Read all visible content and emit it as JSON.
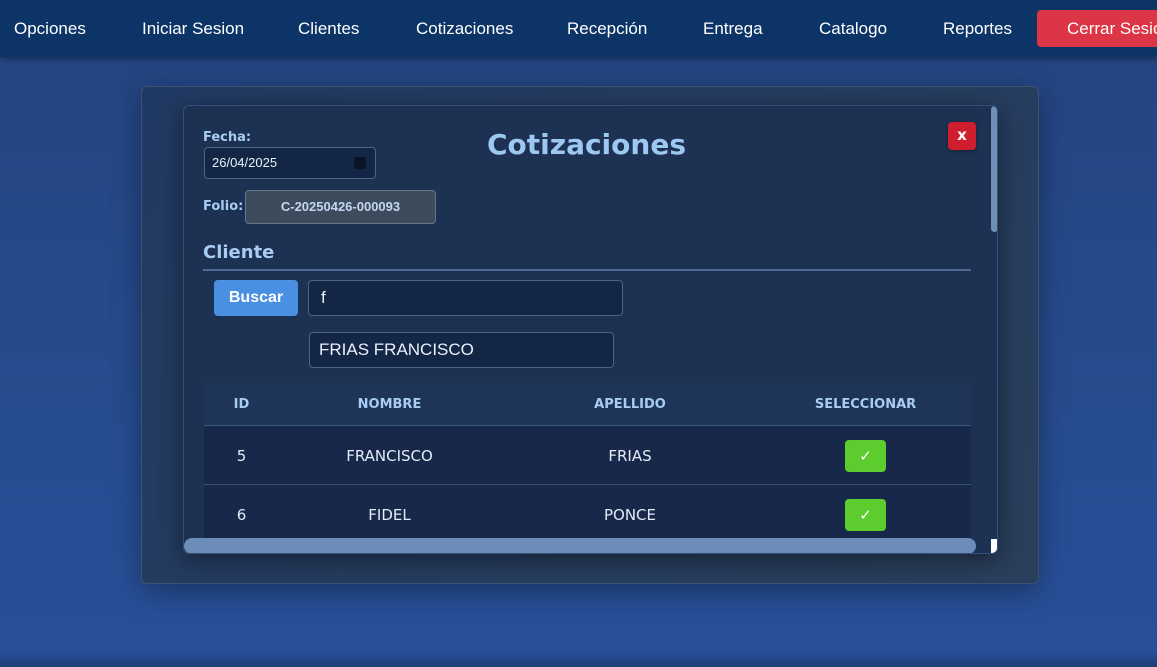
{
  "nav": {
    "items": [
      "Opciones",
      "Iniciar Sesion",
      "Clientes",
      "Cotizaciones",
      "Recepción",
      "Entrega",
      "Catalogo",
      "Reportes"
    ],
    "logout_label": "Cerrar Sesion",
    "logout_color": "#dc3545"
  },
  "modal": {
    "title": "Cotizaciones",
    "close_label": "x",
    "fecha_label": "Fecha:",
    "fecha_value": "26/04/2025",
    "folio_label": "Folio:",
    "folio_value": "C-20250426-000093",
    "section_title": "Cliente",
    "buscar_label": "Buscar",
    "search_value": "f",
    "result_value": "FRIAS FRANCISCO"
  },
  "table": {
    "headers": [
      "ID",
      "NOMBRE",
      "APELLIDO",
      "SELECCIONAR"
    ],
    "rows": [
      {
        "id": "5",
        "nombre": "FRANCISCO",
        "apellido": "FRIAS",
        "select": "✓"
      },
      {
        "id": "6",
        "nombre": "FIDEL",
        "apellido": "PONCE",
        "select": "✓"
      }
    ]
  },
  "icons": {
    "calendar": "calendar-icon",
    "check": "check-icon"
  },
  "colors": {
    "nav_bg": "#0c3466",
    "accent": "#4a90e2",
    "select_green": "#5dcc2e",
    "close_red": "#cf1f2e"
  }
}
